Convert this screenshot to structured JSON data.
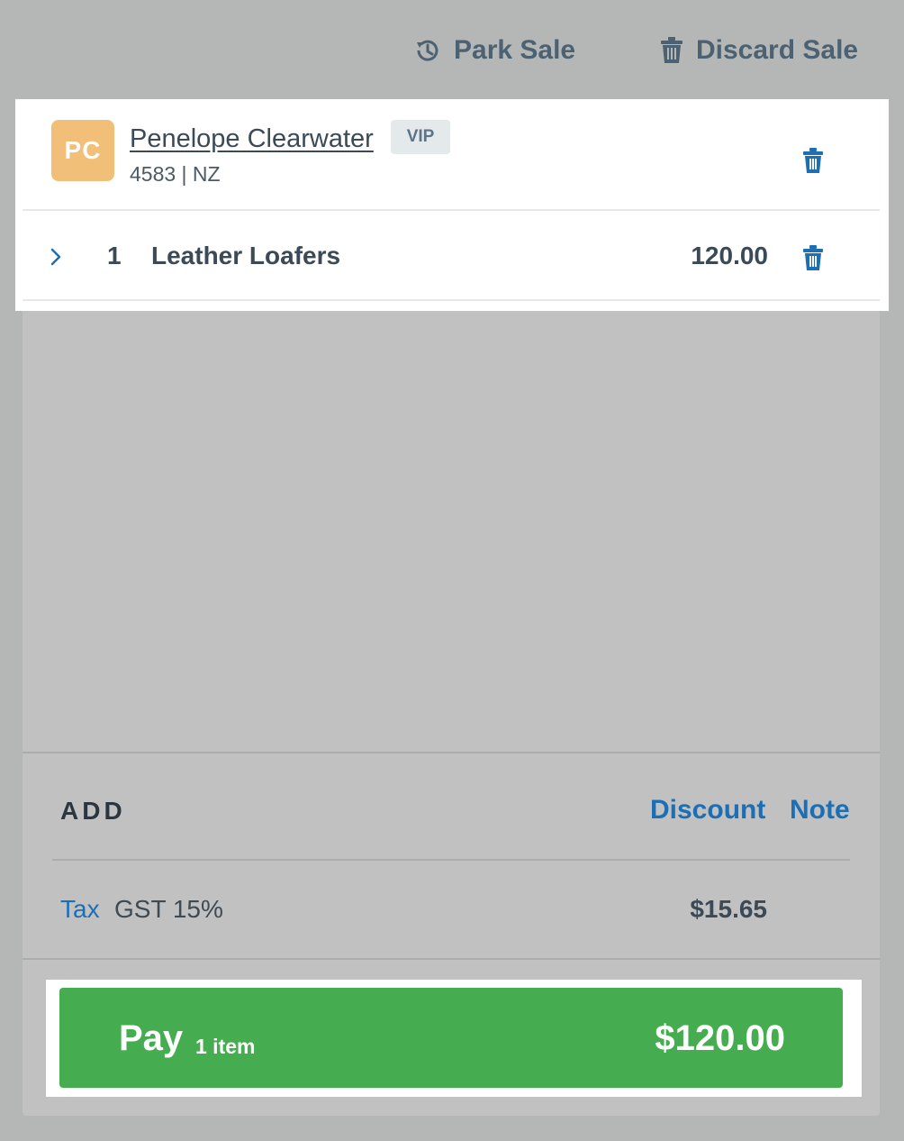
{
  "topbar": {
    "park_sale": "Park Sale",
    "discard_sale": "Discard Sale"
  },
  "customer": {
    "initials": "PC",
    "name": "Penelope Clearwater",
    "badge": "VIP",
    "meta": "4583 | NZ"
  },
  "line_items": [
    {
      "qty": "1",
      "name": "Leather Loafers",
      "price": "120.00"
    }
  ],
  "add": {
    "label": "ADD",
    "discount": "Discount",
    "note": "Note"
  },
  "tax": {
    "label": "Tax",
    "name": "GST 15%",
    "amount": "$15.65"
  },
  "pay": {
    "label": "Pay",
    "count": "1 item",
    "total": "$120.00"
  },
  "colors": {
    "accent_blue": "#1d6fb5",
    "pay_green": "#45ad50",
    "avatar": "#f1bf78",
    "text_dark": "#3b4a56"
  },
  "icons": {
    "park": "history-icon",
    "discard": "trash-icon",
    "expand": "chevron-right-icon"
  }
}
